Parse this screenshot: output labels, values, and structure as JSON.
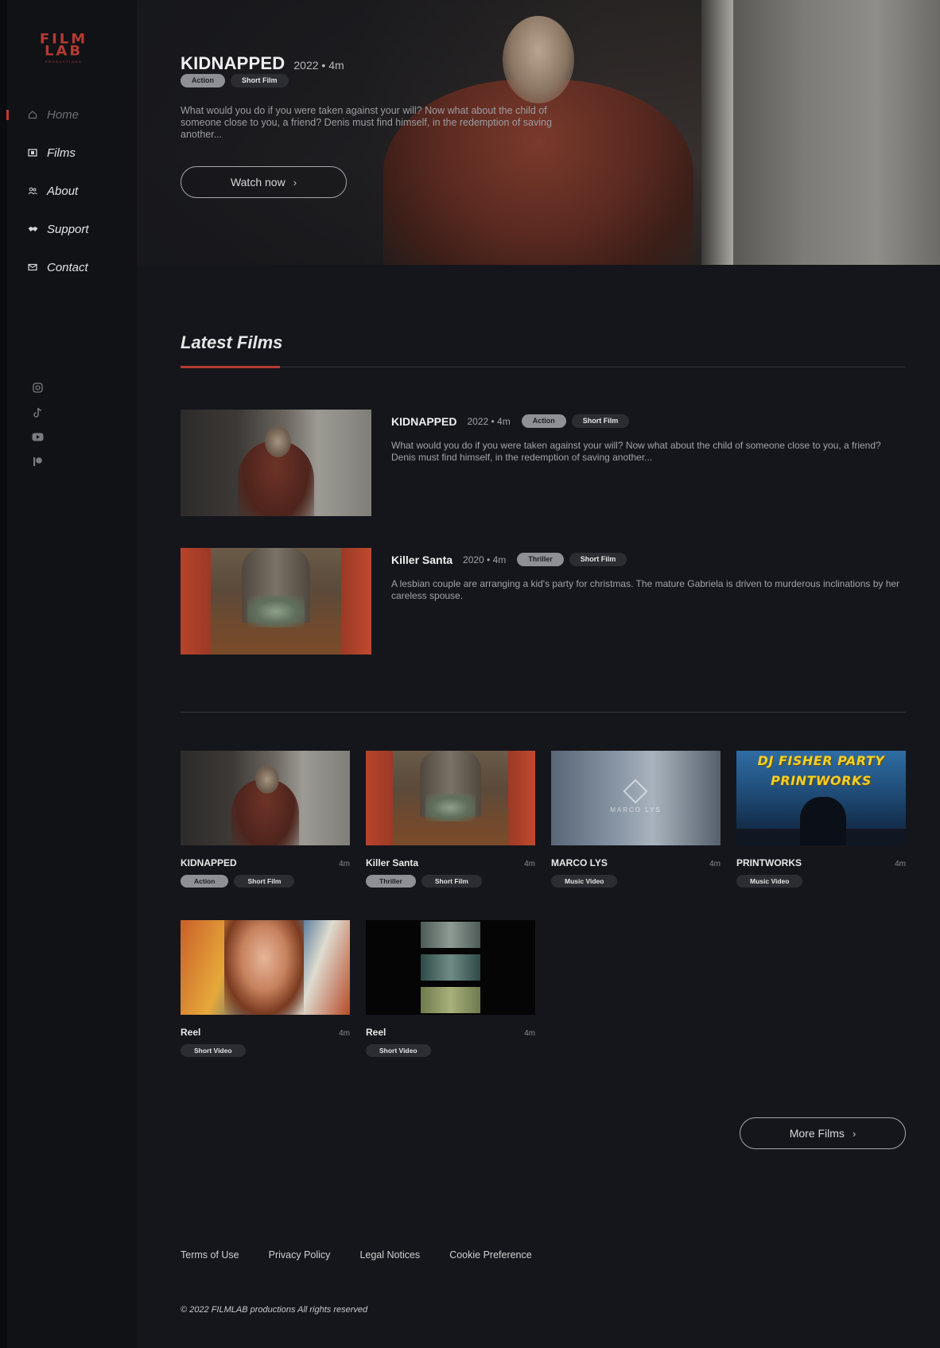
{
  "brand": {
    "logo_line1": "FILM",
    "logo_line2": "LAB",
    "logo_line3": "PRODUCTIONS"
  },
  "nav": [
    {
      "label": "Home",
      "icon": "home-icon",
      "active": true
    },
    {
      "label": "Films",
      "icon": "film-icon"
    },
    {
      "label": "About",
      "icon": "users-icon"
    },
    {
      "label": "Support",
      "icon": "handshake-icon"
    },
    {
      "label": "Contact",
      "icon": "mail-icon"
    }
  ],
  "socials": [
    "instagram-icon",
    "tiktok-icon",
    "youtube-icon",
    "patreon-icon"
  ],
  "hero": {
    "title": "KIDNAPPED",
    "meta": "2022 • 4m",
    "tags": [
      "Action",
      "Short Film"
    ],
    "description": "What would you do if you were taken against your will? Now what about the child of someone close to you, a friend? Denis must find himself, in the redemption of saving another...",
    "button": "Watch now"
  },
  "latest": {
    "title": "Latest Films",
    "items": [
      {
        "title": "KIDNAPPED",
        "meta": "2022 • 4m",
        "tags": [
          "Action",
          "Short Film"
        ],
        "description": "What would you do if you were taken against your will? Now what about the child of someone close to you, a friend? Denis must find himself, in the redemption of saving another..."
      },
      {
        "title": "Killer Santa",
        "meta": "2020 • 4m",
        "tags": [
          "Thriller",
          "Short Film"
        ],
        "description": "A lesbian couple are arranging a kid's party for christmas. The mature Gabriela is driven to murderous inclinations by her careless spouse."
      }
    ]
  },
  "grid": [
    {
      "title": "KIDNAPPED",
      "duration": "4m",
      "tags": [
        "Action",
        "Short Film"
      ]
    },
    {
      "title": "Killer Santa",
      "duration": "4m",
      "tags": [
        "Thriller",
        "Short Film"
      ]
    },
    {
      "title": "MARCO LYS",
      "duration": "4m",
      "tags": [
        "Music Video"
      ],
      "thumb_text": "MARCO LYS"
    },
    {
      "title": "PRINTWORKS",
      "duration": "4m",
      "tags": [
        "Music Video"
      ],
      "thumb_text_1": "DJ FISHER PARTY",
      "thumb_text_2": "PRINTWORKS"
    },
    {
      "title": "Reel",
      "duration": "4m",
      "tags": [
        "Short Video"
      ]
    },
    {
      "title": "Reel",
      "duration": "4m",
      "tags": [
        "Short Video"
      ]
    }
  ],
  "more_button": "More Films",
  "footer": {
    "links": [
      "Terms of Use",
      "Privacy Policy",
      "Legal Notices",
      "Cookie Preference"
    ],
    "copyright": "© 2022 FILMLAB productions All rights reserved"
  },
  "colors": {
    "accent": "#b53a32",
    "background": "#15161b",
    "sidebar": "#111216"
  }
}
